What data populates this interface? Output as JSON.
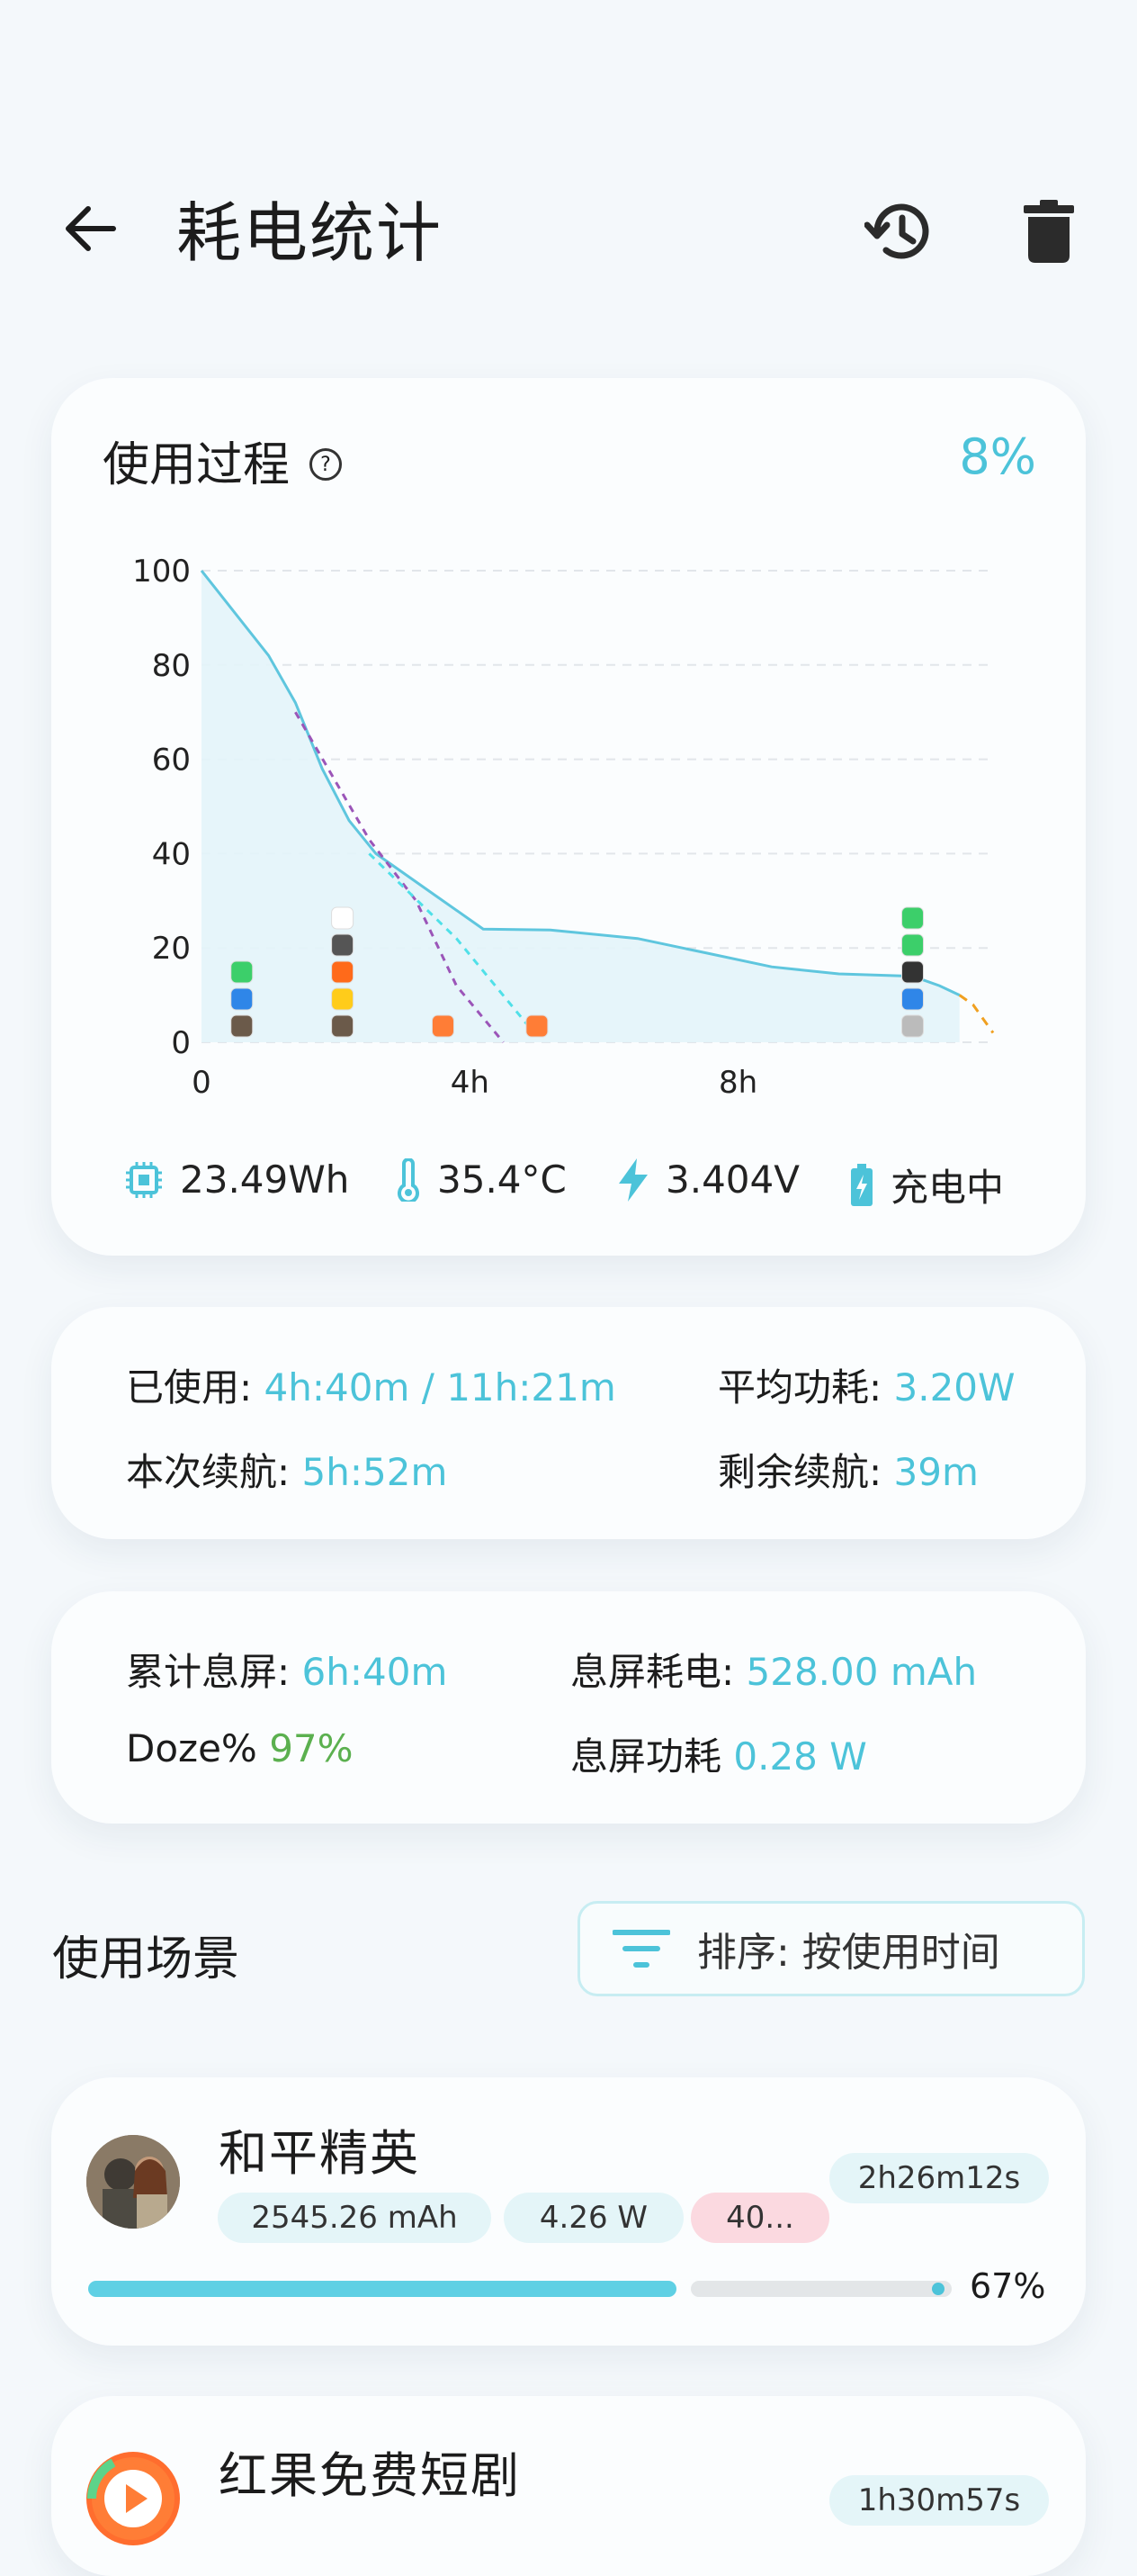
{
  "header": {
    "title": "耗电统计",
    "back_icon": "arrow-left-icon",
    "history_icon": "history-icon",
    "delete_icon": "trash-icon"
  },
  "usage_card": {
    "title": "使用过程",
    "battery_percent": "8%",
    "stats": {
      "energy": "23.49Wh",
      "temperature": "35.4°C",
      "voltage": "3.404V",
      "status": "充电中"
    }
  },
  "chart_data": {
    "type": "line",
    "x_tick_labels": [
      "0",
      "4h",
      "8h"
    ],
    "y_tick_labels": [
      "0",
      "20",
      "40",
      "60",
      "80",
      "100"
    ],
    "xlim": [
      0,
      11.8
    ],
    "ylim": [
      0,
      100
    ],
    "grid": true,
    "series": [
      {
        "values_xy": [
          [
            0,
            100
          ],
          [
            0.5,
            91
          ],
          [
            1,
            82
          ],
          [
            1.4,
            72
          ],
          [
            1.8,
            58
          ],
          [
            2.2,
            47
          ],
          [
            2.6,
            40
          ],
          [
            3,
            36
          ],
          [
            3.5,
            31
          ],
          [
            4.2,
            24
          ],
          [
            5.2,
            23.8
          ],
          [
            6.5,
            22
          ],
          [
            7.5,
            19
          ],
          [
            8.5,
            16
          ],
          [
            9.5,
            14.5
          ],
          [
            10.6,
            14
          ],
          [
            11,
            12
          ],
          [
            11.3,
            10
          ]
        ]
      },
      {
        "values_xy": [
          [
            11.3,
            10
          ],
          [
            11.5,
            8
          ],
          [
            11.8,
            2
          ]
        ],
        "style": "dashed-orange"
      },
      {
        "values_xy": [
          [
            1.4,
            70
          ],
          [
            2.5,
            43
          ],
          [
            3.2,
            30
          ],
          [
            3.8,
            12
          ],
          [
            4.5,
            0
          ]
        ],
        "style": "dashed-purple"
      },
      {
        "values_xy": [
          [
            2.5,
            40
          ],
          [
            3.8,
            22
          ],
          [
            4.9,
            3
          ]
        ],
        "style": "dashed-cyan"
      }
    ],
    "colors": {
      "line": "#5fc6de",
      "fill": "#e3f4f9"
    }
  },
  "usage_summary": {
    "used_label": "已使用:",
    "used_value": "4h:40m / 11h:21m",
    "avg_power_label": "平均功耗:",
    "avg_power_value": "3.20W",
    "endurance_label": "本次续航:",
    "endurance_value": "5h:52m",
    "remaining_label": "剩余续航:",
    "remaining_value": "39m"
  },
  "screen_off": {
    "total_label": "累计息屏:",
    "total_value": "6h:40m",
    "drain_label": "息屏耗电:",
    "drain_value": "528.00 mAh",
    "doze_label": "Doze%",
    "doze_value": "97%",
    "power_label": "息屏功耗",
    "power_value": "0.28 W"
  },
  "scenes": {
    "title": "使用场景",
    "sort_label": "排序: 按使用时间",
    "apps": [
      {
        "name": "和平精英",
        "capacity": "2545.26 mAh",
        "power": "4.26 W",
        "temp": "40...",
        "duration": "2h26m12s",
        "percent": "67%",
        "progress": 0.67
      },
      {
        "name": "红果免费短剧",
        "duration": "1h30m57s"
      }
    ]
  }
}
